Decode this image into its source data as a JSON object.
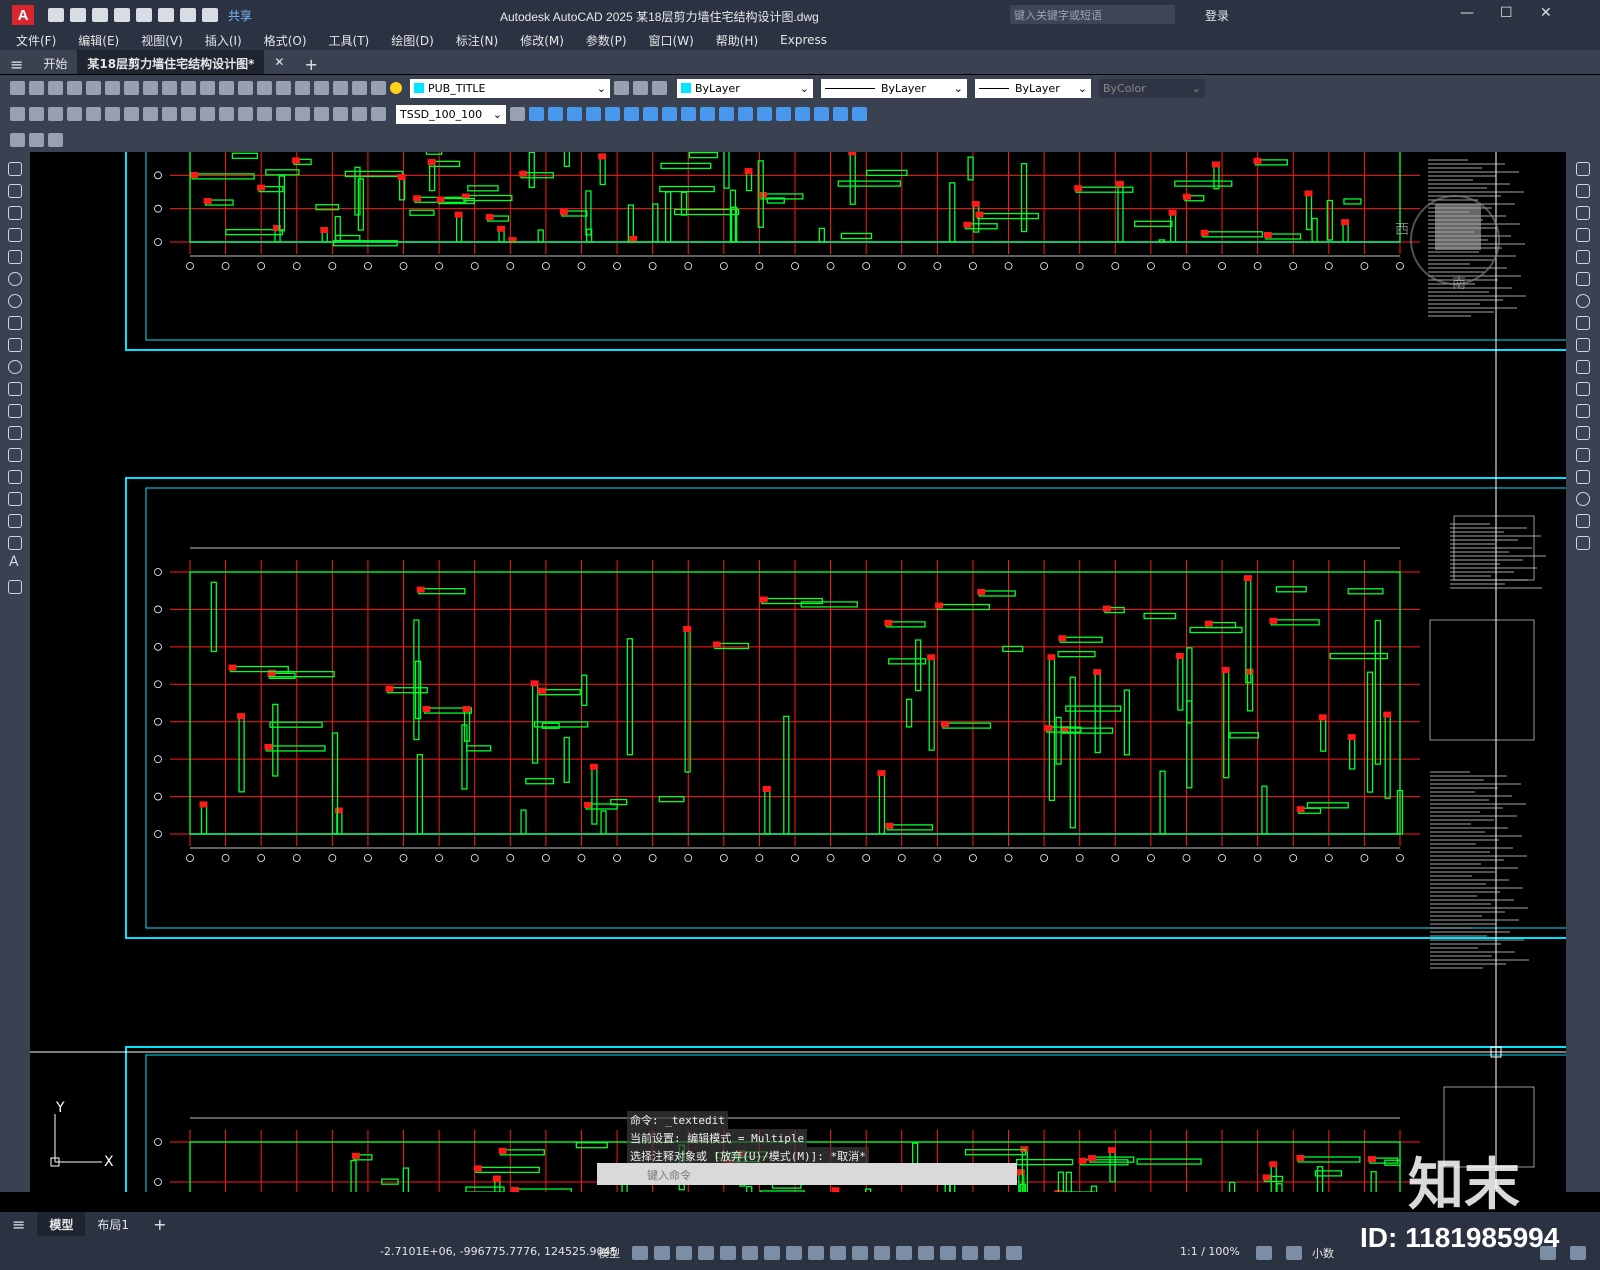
{
  "app": {
    "logo": "A",
    "title": "Autodesk AutoCAD 2025    某18层剪力墙住宅结构设计图.dwg",
    "share_label": "共享",
    "search_placeholder": "键入关键字或短语",
    "login_label": "登录"
  },
  "menu": [
    "文件(F)",
    "编辑(E)",
    "视图(V)",
    "插入(I)",
    "格式(O)",
    "工具(T)",
    "绘图(D)",
    "标注(N)",
    "修改(M)",
    "参数(P)",
    "窗口(W)",
    "帮助(H)",
    "Express"
  ],
  "tabs": {
    "start": "开始",
    "document": "某18层剪力墙住宅结构设计图*"
  },
  "properties": {
    "layer": "PUB_TITLE",
    "color": "ByLayer",
    "linetype": "ByLayer",
    "lineweight": "ByLayer",
    "plotstyle": "ByColor",
    "dimstyle": "TSSD_100_100"
  },
  "command": {
    "history": [
      "命令: _textedit",
      "当前设置: 编辑模式 = Multiple",
      "选择注释对象或 [放弃(U)/模式(M)]: *取消*"
    ],
    "input_placeholder": "键入命令"
  },
  "layout_tabs": {
    "model": "模型",
    "layout1": "布局1"
  },
  "status": {
    "coords": "-2.7101E+06, -996775.7776, 124525.9045",
    "space": "模型",
    "scale": "1:1 / 100%",
    "units": "小数"
  },
  "ucs": {
    "x": "X",
    "y": "Y"
  },
  "viewcube": {
    "west": "西",
    "south": "南"
  },
  "watermark": {
    "brand": "知末",
    "id": "ID: 1181985994"
  },
  "colors": {
    "accent_red": "#d9262c",
    "cad_green": "#00ff2a",
    "cad_red": "#ff1a1a",
    "cad_cyan": "#00e5ff",
    "cad_blue": "#3a3aff"
  }
}
